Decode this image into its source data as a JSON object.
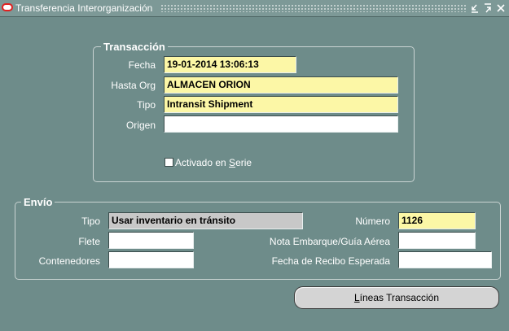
{
  "window": {
    "title": "Transferencia Interorganización",
    "controls": [
      "minimize-icon",
      "maximize-icon",
      "close-icon"
    ]
  },
  "transaccion": {
    "title": "Transacción",
    "fecha_label": "Fecha",
    "fecha_value": "19-01-2014 13:06:13",
    "hasta_org_label": "Hasta Org",
    "hasta_org_value": "ALMACEN ORION",
    "tipo_label": "Tipo",
    "tipo_value": "Intransit Shipment",
    "origen_label": "Origen",
    "origen_value": "",
    "activado_label": "Activado en Serie",
    "activado_checked": false
  },
  "envio": {
    "title": "Envío",
    "tipo_label": "Tipo",
    "tipo_value": "Usar inventario en tránsito",
    "flete_label": "Flete",
    "flete_value": "",
    "contenedores_label": "Contenedores",
    "contenedores_value": "",
    "numero_label": "Número",
    "numero_value": "1126",
    "nota_label": "Nota Embarque/Guía Aérea",
    "nota_value": "",
    "fecha_recibo_label": "Fecha de Recibo Esperada",
    "fecha_recibo_value": ""
  },
  "buttons": {
    "lineas_label": "Líneas Transacción"
  },
  "colors": {
    "background": "#6e8c8a",
    "required_field": "#fcf7a6",
    "readonly_field": "#c8c8c8",
    "logo_red": "#e02020"
  }
}
